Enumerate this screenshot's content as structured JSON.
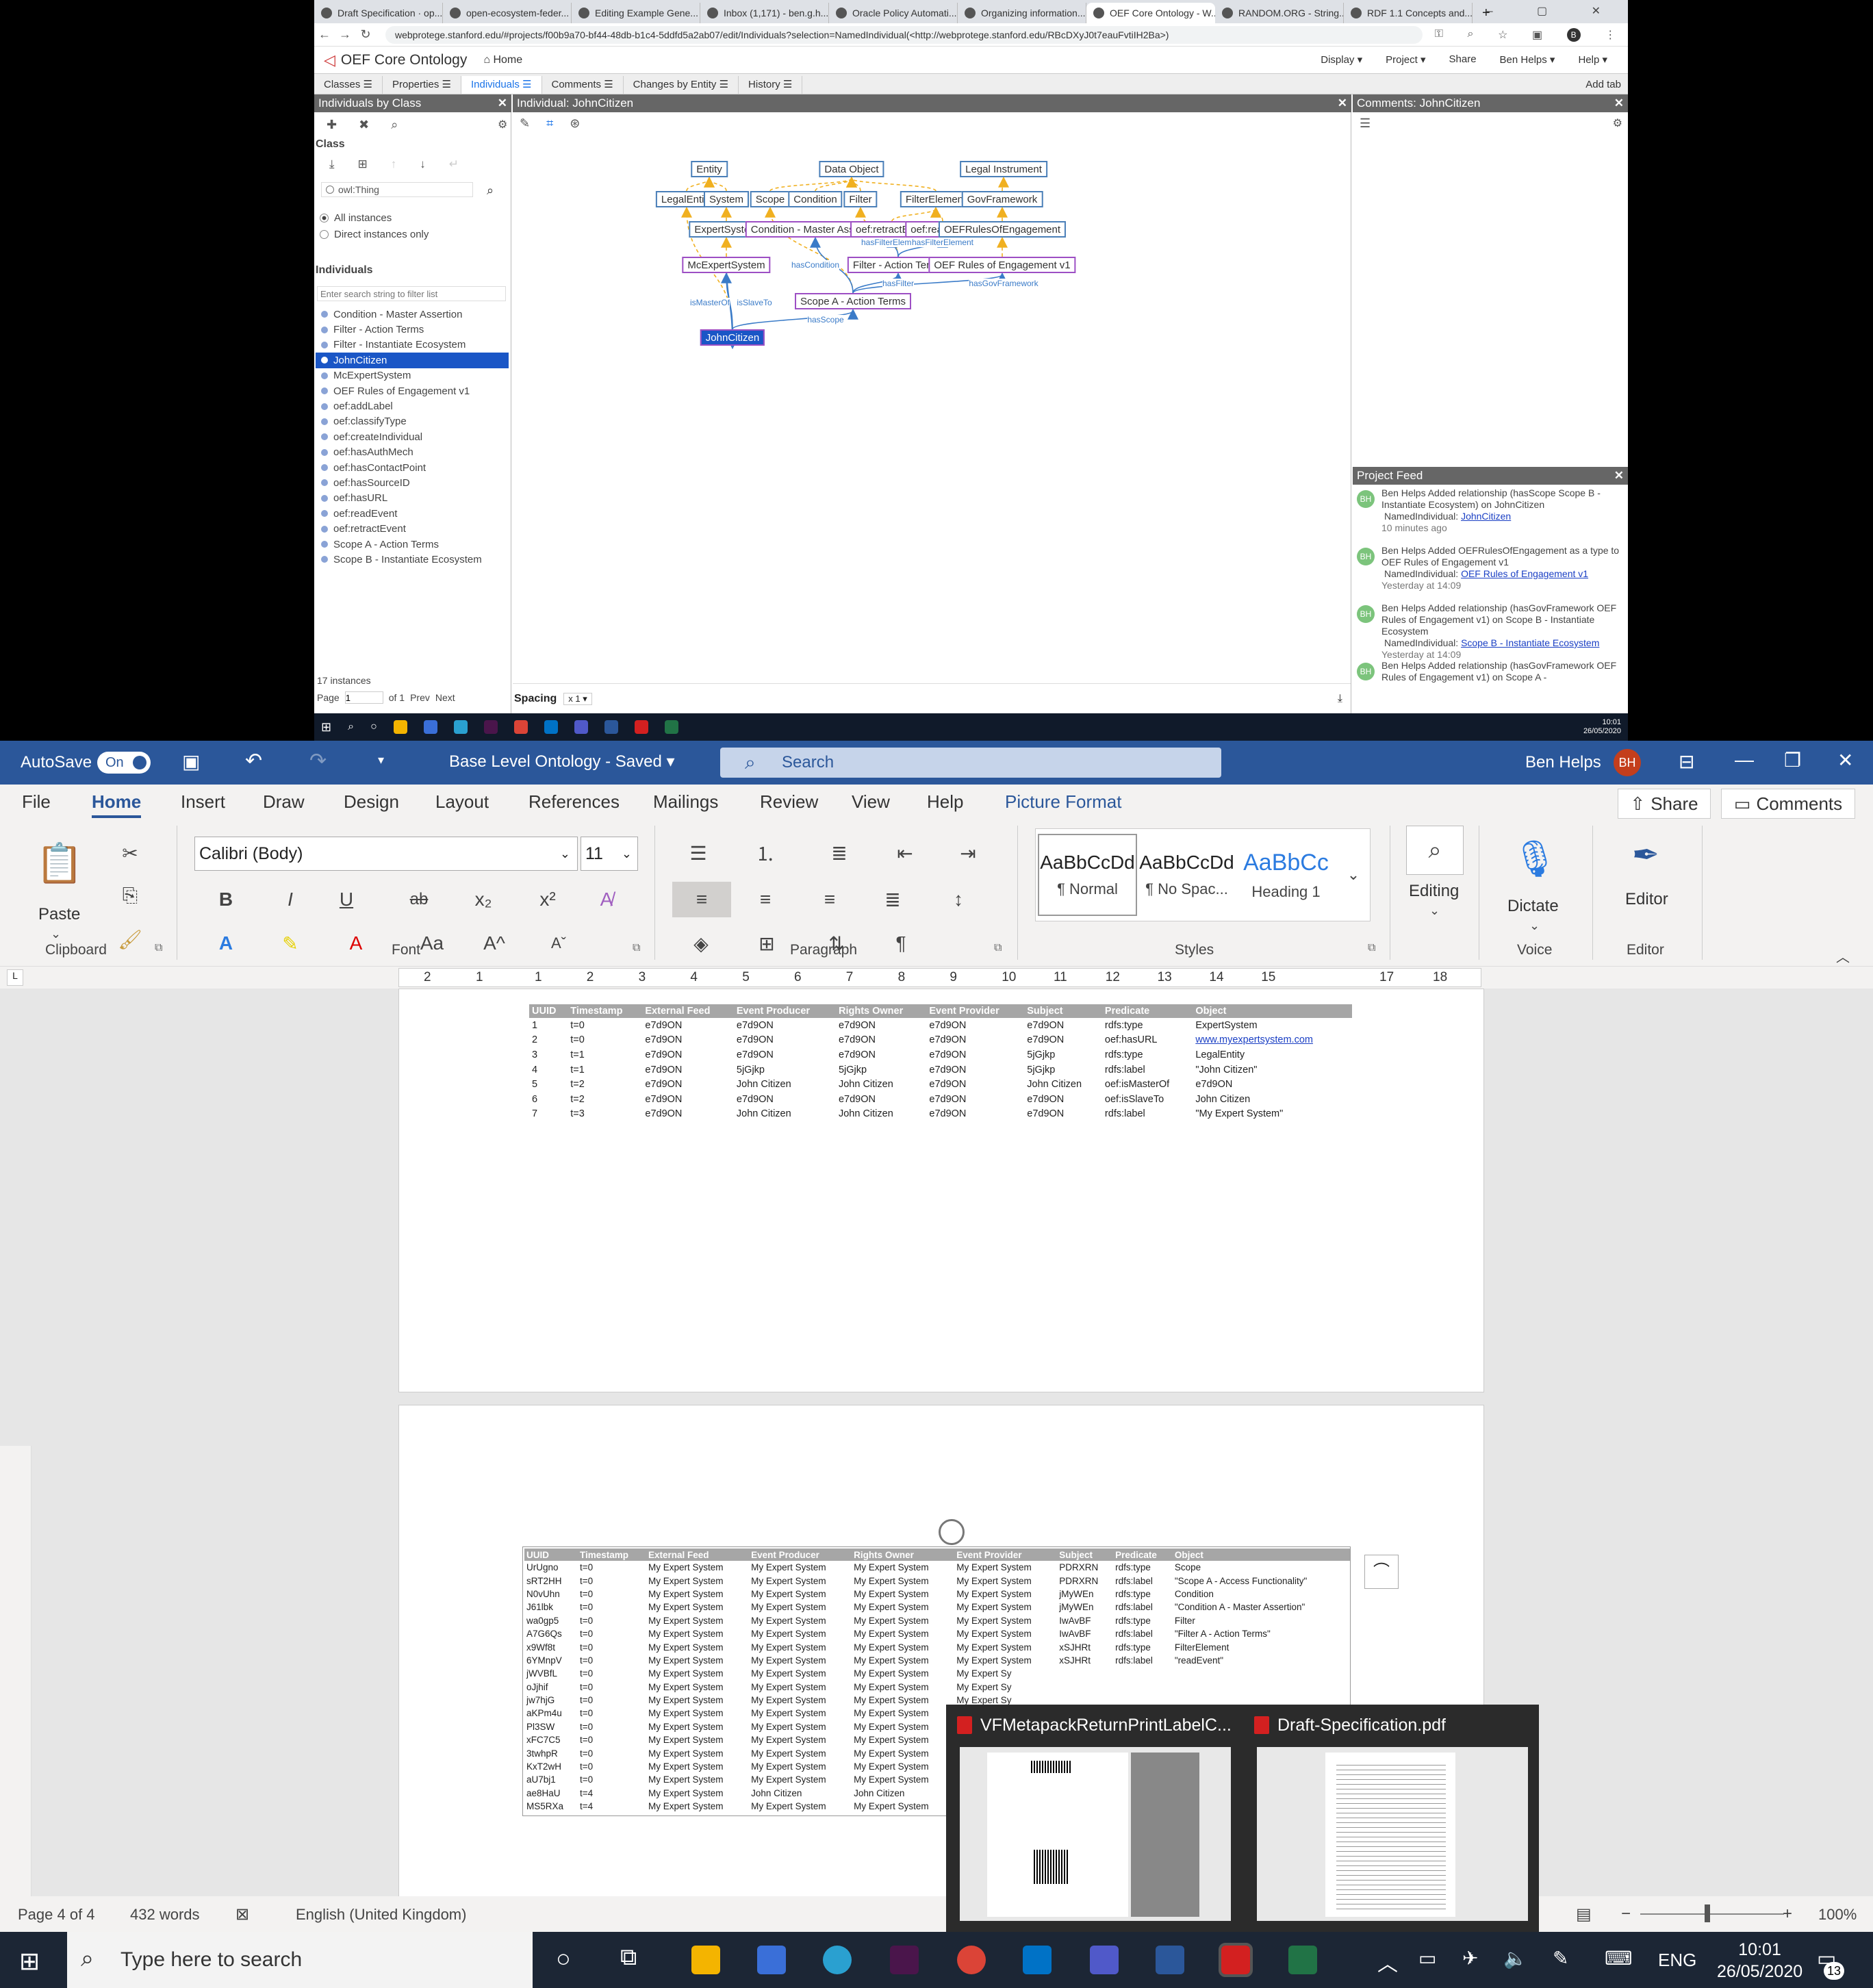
{
  "browser": {
    "tabs": [
      "Draft Specification · op...",
      "open-ecosystem-feder...",
      "Editing Example Gene...",
      "Inbox (1,171) - ben.g.h...",
      "Oracle Policy Automati...",
      "Organizing information...",
      "OEF Core Ontology - W...",
      "RANDOM.ORG - String...",
      "RDF 1.1 Concepts and..."
    ],
    "active_tab_index": 6,
    "url": "webprotege.stanford.edu/#projects/f00b9a70-bf44-48db-b1c4-5ddfd5a2ab07/edit/Individuals?selection=NamedIndividual(<http://webprotege.stanford.edu/RBcDXyJ0t7eauFvtiIH2Ba>)",
    "profile_initial": "B"
  },
  "webprotege": {
    "project_title": "OEF Core Ontology",
    "home_label": "Home",
    "menu": [
      "Display ▾",
      "Project ▾",
      "Share",
      "Ben Helps ▾",
      "Help ▾"
    ],
    "tabs": [
      "Classes",
      "Properties",
      "Individuals",
      "Comments",
      "Changes by Entity",
      "History"
    ],
    "active_tab": "Individuals",
    "add_tab": "Add tab",
    "left_panel": {
      "title": "Individuals by Class",
      "class_label": "Class",
      "class_value": "owl:Thing",
      "radio_all": "All instances",
      "radio_direct": "Direct instances only",
      "individuals_label": "Individuals",
      "filter_placeholder": "Enter search string to filter list",
      "items": [
        "Condition - Master Assertion",
        "Filter - Action Terms",
        "Filter - Instantiate Ecosystem",
        "JohnCitizen",
        "McExpertSystem",
        "OEF Rules of Engagement v1",
        "oef:addLabel",
        "oef:classifyType",
        "oef:createIndividual",
        "oef:hasAuthMech",
        "oef:hasContactPoint",
        "oef:hasSourceID",
        "oef:hasURL",
        "oef:readEvent",
        "oef:retractEvent",
        "Scope A - Action Terms",
        "Scope B - Instantiate Ecosystem"
      ],
      "selected_item": "JohnCitizen",
      "count": "17 instances",
      "page_label": "Page",
      "page_value": "1",
      "of_label": "of 1",
      "prev": "Prev",
      "next": "Next"
    },
    "center_panel": {
      "title": "Individual: JohnCitizen",
      "spacing_label": "Spacing",
      "spacing_value": "x 1"
    },
    "graph": {
      "nodes": [
        "Entity",
        "Data Object",
        "Legal Instrument",
        "LegalEntity",
        "System",
        "Scope",
        "Condition",
        "Filter",
        "FilterElement",
        "GovFramework",
        "ExpertSystem",
        "Condition - Master Assertion",
        "oef:retractEvent",
        "oef:readEvent",
        "OEFRulesOfEngagement",
        "McExpertSystem",
        "Filter - Action Terms",
        "OEF Rules of Engagement v1",
        "Scope A - Action Terms",
        "JohnCitizen"
      ],
      "edge_labels": [
        "hasFilterElement",
        "hasFilterElement",
        "hasCondition",
        "hasFilter",
        "hasGovFramework",
        "isMasterOf",
        "isSlaveTo",
        "hasScope"
      ]
    },
    "comments_panel": {
      "title": "Comments: JohnCitizen"
    },
    "feed": {
      "title": "Project Feed",
      "items": [
        {
          "avatar": "BH",
          "text": "Ben Helps Added relationship (hasScope Scope B - Instantiate Ecosystem) on JohnCitizen",
          "sub": "NamedIndividual: ",
          "link": "JohnCitizen",
          "time": "10 minutes ago"
        },
        {
          "avatar": "BH",
          "text": "Ben Helps Added OEFRulesOfEngagement as a type to OEF Rules of Engagement v1",
          "sub": "NamedIndividual: ",
          "link": "OEF Rules of Engagement v1",
          "time": "Yesterday at 14:09"
        },
        {
          "avatar": "BH",
          "text": "Ben Helps Added relationship (hasGovFramework OEF Rules of Engagement v1) on Scope B - Instantiate Ecosystem",
          "sub": "NamedIndividual: ",
          "link": "Scope B - Instantiate Ecosystem",
          "time": "Yesterday at 14:09"
        },
        {
          "avatar": "BH",
          "text": "Ben Helps Added relationship (hasGovFramework OEF Rules of Engagement v1) on Scope A -",
          "sub": "",
          "link": "",
          "time": ""
        }
      ]
    },
    "inner_clock": {
      "time": "10:01",
      "date": "26/05/2020"
    }
  },
  "word": {
    "autosave_label": "AutoSave",
    "autosave_state": "On",
    "doc_title": "Base Level Ontology - Saved",
    "search_placeholder": "Search",
    "user_name": "Ben Helps",
    "user_initials": "BH",
    "menu": [
      "File",
      "Home",
      "Insert",
      "Draw",
      "Design",
      "Layout",
      "References",
      "Mailings",
      "Review",
      "View",
      "Help",
      "Picture Format"
    ],
    "active_menu": "Home",
    "share": "Share",
    "comments": "Comments",
    "ribbon": {
      "paste": "Paste",
      "clipboard": "Clipboard",
      "font_name": "Calibri (Body)",
      "font_size": "11",
      "font": "Font",
      "paragraph": "Paragraph",
      "styles_label": "Styles",
      "styles": [
        {
          "preview": "AaBbCcDd",
          "name": "¶ Normal"
        },
        {
          "preview": "AaBbCcDd",
          "name": "¶ No Spac..."
        },
        {
          "preview": "AaBbCc",
          "name": "Heading 1"
        }
      ],
      "editing": "Editing",
      "dictate": "Dictate",
      "voice": "Voice",
      "editor": "Editor",
      "editor_group": "Editor"
    },
    "ruler": [
      "2",
      "1",
      "1",
      "2",
      "3",
      "4",
      "5",
      "6",
      "7",
      "8",
      "9",
      "10",
      "11",
      "12",
      "13",
      "14",
      "15",
      "17",
      "18"
    ],
    "table1": {
      "headers": [
        "UUID",
        "Timestamp",
        "External Feed",
        "Event Producer",
        "Rights Owner",
        "Event Provider",
        "Subject",
        "Predicate",
        "Object"
      ],
      "rows": [
        [
          "1",
          "t=0",
          "e7d9ON",
          "e7d9ON",
          "e7d9ON",
          "e7d9ON",
          "e7d9ON",
          "rdfs:type",
          "ExpertSystem"
        ],
        [
          "2",
          "t=0",
          "e7d9ON",
          "e7d9ON",
          "e7d9ON",
          "e7d9ON",
          "e7d9ON",
          "oef:hasURL",
          "www.myexpertsystem.com"
        ],
        [
          "3",
          "t=1",
          "e7d9ON",
          "e7d9ON",
          "e7d9ON",
          "e7d9ON",
          "5jGjkp",
          "rdfs:type",
          "LegalEntity"
        ],
        [
          "4",
          "t=1",
          "e7d9ON",
          "5jGjkp",
          "5jGjkp",
          "e7d9ON",
          "5jGjkp",
          "rdfs:label",
          "\"John Citizen\""
        ],
        [
          "5",
          "t=2",
          "e7d9ON",
          "John Citizen",
          "John Citizen",
          "e7d9ON",
          "John Citizen",
          "oef:isMasterOf",
          "e7d9ON"
        ],
        [
          "6",
          "t=2",
          "e7d9ON",
          "e7d9ON",
          "e7d9ON",
          "e7d9ON",
          "e7d9ON",
          "oef:isSlaveTo",
          "John Citizen"
        ],
        [
          "7",
          "t=3",
          "e7d9ON",
          "John Citizen",
          "John Citizen",
          "e7d9ON",
          "e7d9ON",
          "rdfs:label",
          "\"My Expert System\""
        ]
      ]
    },
    "table2": {
      "headers": [
        "UUID",
        "Timestamp",
        "External Feed",
        "Event Producer",
        "Rights Owner",
        "Event Provider",
        "Subject",
        "Predicate",
        "Object"
      ],
      "rows": [
        [
          "UrUgno",
          "t=0",
          "My Expert System",
          "My Expert System",
          "My Expert System",
          "My Expert System",
          "PDRXRN",
          "rdfs:type",
          "Scope"
        ],
        [
          "sRT2HH",
          "t=0",
          "My Expert System",
          "My Expert System",
          "My Expert System",
          "My Expert System",
          "PDRXRN",
          "rdfs:label",
          "\"Scope A - Access Functionality\""
        ],
        [
          "N0vUhn",
          "t=0",
          "My Expert System",
          "My Expert System",
          "My Expert System",
          "My Expert System",
          "jMyWEn",
          "rdfs:type",
          "Condition"
        ],
        [
          "J61lbk",
          "t=0",
          "My Expert System",
          "My Expert System",
          "My Expert System",
          "My Expert System",
          "jMyWEn",
          "rdfs:label",
          "\"Condition A - Master Assertion\""
        ],
        [
          "wa0gp5",
          "t=0",
          "My Expert System",
          "My Expert System",
          "My Expert System",
          "My Expert System",
          "IwAvBF",
          "rdfs:type",
          "Filter"
        ],
        [
          "A7G6Qs",
          "t=0",
          "My Expert System",
          "My Expert System",
          "My Expert System",
          "My Expert System",
          "IwAvBF",
          "rdfs:label",
          "\"Filter A - Action Terms\""
        ],
        [
          "x9Wf8t",
          "t=0",
          "My Expert System",
          "My Expert System",
          "My Expert System",
          "My Expert System",
          "xSJHRt",
          "rdfs:type",
          "FilterElement"
        ],
        [
          "6YMnpV",
          "t=0",
          "My Expert System",
          "My Expert System",
          "My Expert System",
          "My Expert System",
          "xSJHRt",
          "rdfs:label",
          "\"readEvent\""
        ],
        [
          "jWVBfL",
          "t=0",
          "My Expert System",
          "My Expert System",
          "My Expert System",
          "My Expert Sy",
          "",
          "",
          ""
        ],
        [
          "oJjhif",
          "t=0",
          "My Expert System",
          "My Expert System",
          "My Expert System",
          "My Expert Sy",
          "",
          "",
          ""
        ],
        [
          "jw7hjG",
          "t=0",
          "My Expert System",
          "My Expert System",
          "My Expert System",
          "My Expert Sy",
          "",
          "",
          ""
        ],
        [
          "aKPm4u",
          "t=0",
          "My Expert System",
          "My Expert System",
          "My Expert System",
          "My Expert Sy",
          "",
          "",
          ""
        ],
        [
          "Pl3SW",
          "t=0",
          "My Expert System",
          "My Expert System",
          "My Expert System",
          "My Expert Sy",
          "",
          "",
          ""
        ],
        [
          "xFC7C5",
          "t=0",
          "My Expert System",
          "My Expert System",
          "My Expert System",
          "My Expert Sy",
          "",
          "",
          ""
        ],
        [
          "3twhpR",
          "t=0",
          "My Expert System",
          "My Expert System",
          "My Expert System",
          "My Expert Sy",
          "",
          "",
          ""
        ],
        [
          "KxT2wH",
          "t=0",
          "My Expert System",
          "My Expert System",
          "My Expert System",
          "My Expert Sy",
          "",
          "",
          ""
        ],
        [
          "aU7bj1",
          "t=0",
          "My Expert System",
          "My Expert System",
          "My Expert System",
          "My Expert Sy",
          "",
          "",
          ""
        ],
        [
          "ae8HaU",
          "t=4",
          "My Expert System",
          "John Citizen",
          "John Citizen",
          "My Expert Sy",
          "",
          "",
          ""
        ],
        [
          "MS5RXa",
          "t=4",
          "My Expert System",
          "My Expert System",
          "My Expert System",
          "My Expert Sy",
          "",
          "",
          ""
        ]
      ]
    },
    "status": {
      "page": "Page 4 of 4",
      "words": "432 words",
      "language": "English (United Kingdom)",
      "zoom": "100%"
    }
  },
  "thumbnails": [
    {
      "title": "VFMetapackReturnPrintLabelC..."
    },
    {
      "title": "Draft-Specification.pdf"
    }
  ],
  "taskbar": {
    "search_placeholder": "Type here to search",
    "lang": "ENG",
    "time": "10:01",
    "date": "26/05/2020",
    "notifications": "13"
  }
}
